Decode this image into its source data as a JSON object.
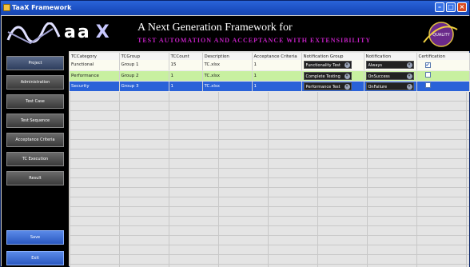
{
  "window": {
    "title": "TaaX Framework"
  },
  "banner": {
    "logo_letters": "aa",
    "logo_x": "X",
    "headline": "A Next Generation Framework for",
    "subline": "TEST AUTOMATION AND ACCEPTANCE WITH EXTENSIBILITY",
    "badge_text": "QUALITY"
  },
  "sidebar": {
    "items": [
      {
        "label": "Project"
      },
      {
        "label": "Administration"
      },
      {
        "label": "Test Case"
      },
      {
        "label": "Test Sequence"
      },
      {
        "label": "Acceptance Criteria"
      },
      {
        "label": "TC Execution"
      },
      {
        "label": "Result"
      }
    ],
    "save_label": "Save",
    "exit_label": "Exit"
  },
  "table": {
    "columns": [
      "TCCategory",
      "TCGroup",
      "TCCount",
      "Description",
      "Acceptance Criteria",
      "Notification Group",
      "Notification",
      "Certification"
    ],
    "rows": [
      {
        "category": "Functional",
        "group": "Group 1",
        "count": "15",
        "description": "TC.xlsx",
        "criteria": "1",
        "notif_group": "Functionality Test",
        "notification": "Always",
        "certified": "✔"
      },
      {
        "category": "Performance",
        "group": "Group 2",
        "count": "1",
        "description": "TC.xlsx",
        "criteria": "1",
        "notif_group": "Complete Testing",
        "notification": "OnSuccess",
        "certified": ""
      },
      {
        "category": "Security",
        "group": "Group 3",
        "count": "1",
        "description": "TC.xlsx",
        "criteria": "1",
        "notif_group": "Performance Test",
        "notification": "OnFailure",
        "certified": ""
      }
    ]
  },
  "colors": {
    "titlebar": "#1c4fc2",
    "selected_row": "#2a62d8",
    "alt_row": "#c8f0a0",
    "banner_bg": "#000000",
    "subline": "#c020c0"
  }
}
